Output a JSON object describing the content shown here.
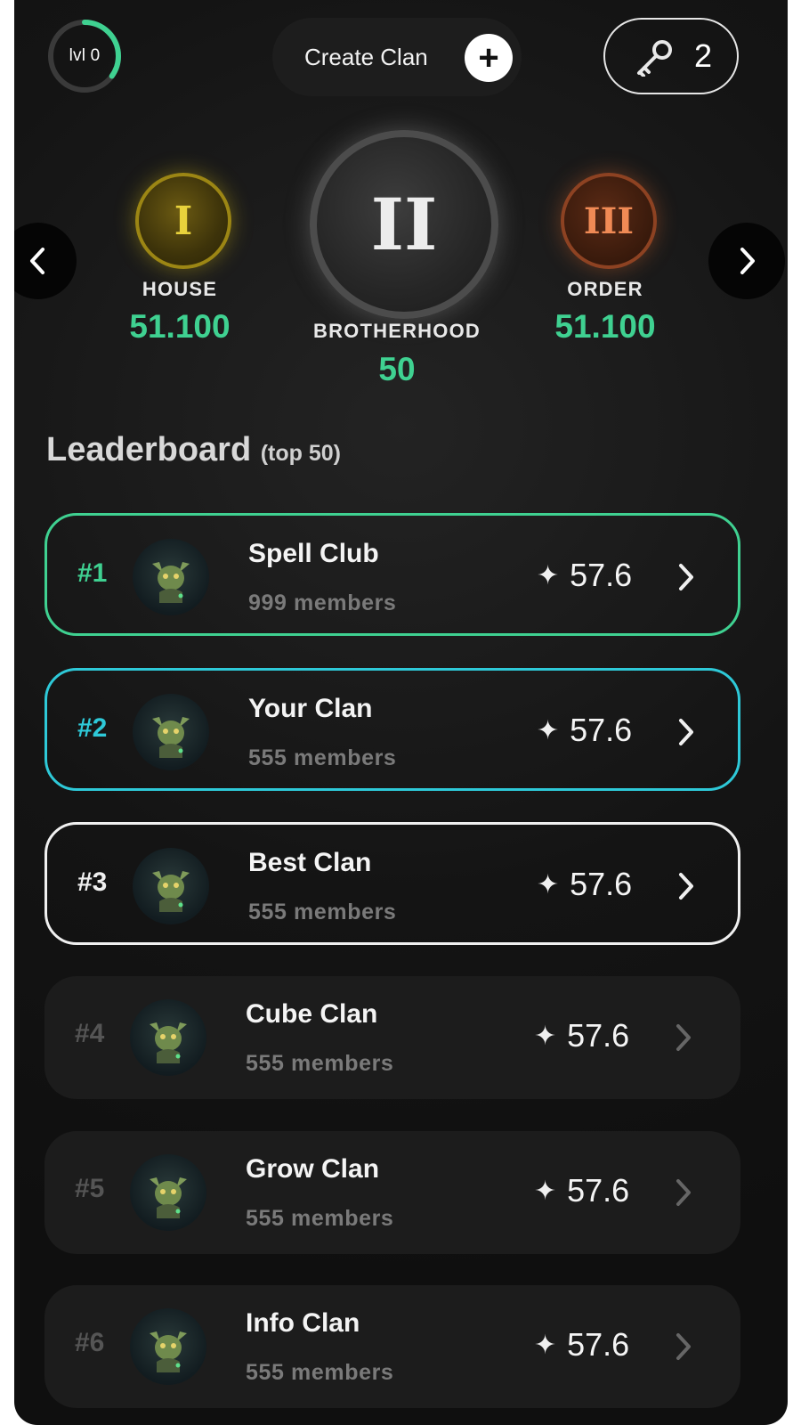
{
  "header": {
    "level_label": "lvl 0",
    "level_progress": 0.35,
    "create_clan_label": "Create Clan",
    "keys_count": "2"
  },
  "carousel": {
    "left": {
      "numeral": "I",
      "name": "HOUSE",
      "score": "51.100",
      "color": "#c9b21c"
    },
    "center": {
      "numeral": "II",
      "name": "BROTHERHOOD",
      "score": "50",
      "color": "#b8b8b8"
    },
    "right": {
      "numeral": "III",
      "name": "ORDER",
      "score": "51.100",
      "color": "#d46a37"
    }
  },
  "leaderboard": {
    "title": "Leaderboard",
    "subtitle": "(top 50)",
    "rows": [
      {
        "rank": "#1",
        "name": "Spell Club",
        "members": "999 members",
        "score": "57.6",
        "accent": "#3fd191"
      },
      {
        "rank": "#2",
        "name": "Your Clan",
        "members": "555 members",
        "score": "57.6",
        "accent": "#2ec9d8"
      },
      {
        "rank": "#3",
        "name": "Best Clan",
        "members": "555 members",
        "score": "57.6",
        "accent": "#f0f0f0"
      },
      {
        "rank": "#4",
        "name": "Cube Clan",
        "members": "555 members",
        "score": "57.6"
      },
      {
        "rank": "#5",
        "name": "Grow Clan",
        "members": "555 members",
        "score": "57.6"
      },
      {
        "rank": "#6",
        "name": "Info Clan",
        "members": "555 members",
        "score": "57.6"
      }
    ]
  },
  "icons": {
    "keys": "key-icon",
    "score": "sparkle-star-icon",
    "row_action": "chevron-right-icon",
    "carousel_prev": "chevron-left-icon",
    "carousel_next": "chevron-right-icon"
  }
}
